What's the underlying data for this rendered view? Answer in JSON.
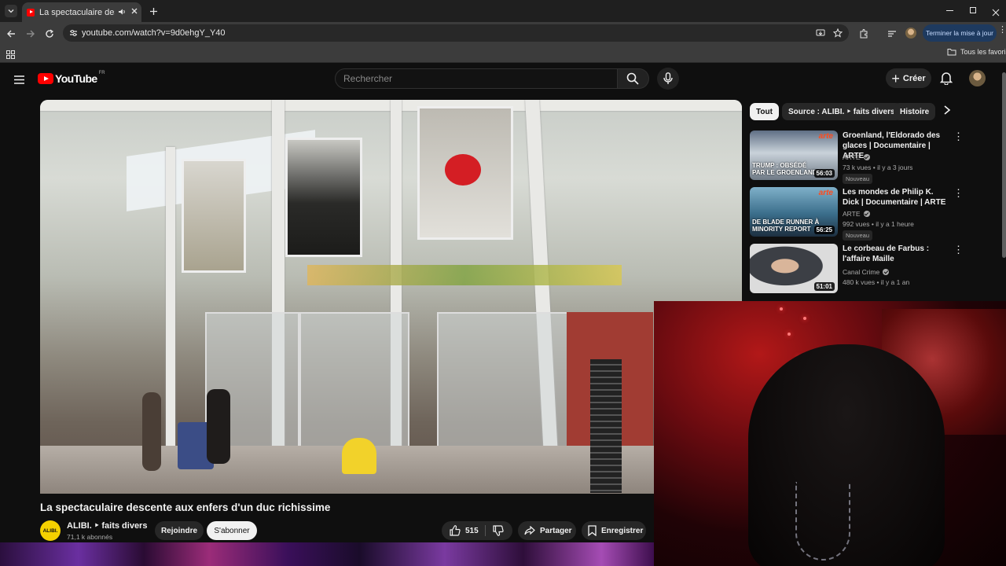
{
  "browser": {
    "tab_title": "La spectaculaire descente aux enfers d'un duc richissime",
    "url": "youtube.com/watch?v=9d0ehgY_Y40",
    "update_button": "Terminer la mise à jour",
    "bookmarks_all": "Tous les favoris"
  },
  "youtube": {
    "logo_text": "YouTube",
    "country_code": "FR",
    "search_placeholder": "Rechercher",
    "create_label": "Créer"
  },
  "video": {
    "title": "La spectaculaire descente aux enfers d'un duc richissime",
    "channel_avatar_text": "ALIBI.",
    "channel_name": "ALIBI. ‣ faits divers",
    "subscribers": "71,1 k abonnés",
    "join_label": "Rejoindre",
    "subscribe_label": "S'abonner",
    "likes": "515",
    "share_label": "Partager",
    "save_label": "Enregistrer"
  },
  "chips": [
    "Tout",
    "Source : ALIBI. ‣ faits divers",
    "Histoire"
  ],
  "recommendations": [
    {
      "title": "Groenland, l'Eldorado des glaces | Documentaire | ARTE",
      "channel": "ARTE",
      "meta": "73 k vues • il y a 3 jours",
      "badge": "Nouveau",
      "duration": "56:03",
      "thumb_text": "TRUMP : OBSÉDÉ PAR LE GROENLAND",
      "thumb_brand": "arte"
    },
    {
      "title": "Les mondes de Philip K. Dick | Documentaire | ARTE",
      "channel": "ARTE",
      "meta": "992 vues • il y a 1 heure",
      "badge": "Nouveau",
      "duration": "56:25",
      "thumb_text": "DE BLADE RUNNER À MINORITY REPORT",
      "thumb_brand": "arte"
    },
    {
      "title": "Le corbeau de Farbus : l'affaire Maille",
      "channel": "Canal Crime",
      "meta": "480 k vues • il y a 1 an",
      "badge": "",
      "duration": "51:01"
    }
  ],
  "colors": {
    "youtube_red": "#ff0000",
    "background": "#0f0f0f",
    "chip_active": "#f1f1f1",
    "alibi_yellow": "#f5d100"
  }
}
